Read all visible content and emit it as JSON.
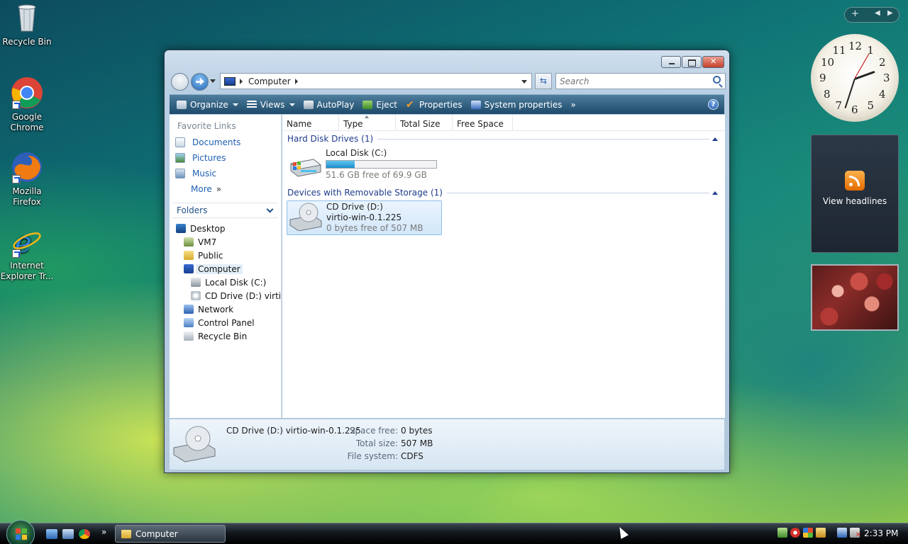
{
  "desktop": {
    "icons": [
      {
        "label": "Recycle Bin",
        "icon": "recycle-bin-icon"
      },
      {
        "label": "Google Chrome",
        "icon": "chrome-icon"
      },
      {
        "label": "Mozilla Firefox",
        "icon": "firefox-icon"
      },
      {
        "label": "Internet Explorer Tr...",
        "icon": "internet-explorer-icon"
      }
    ]
  },
  "window": {
    "address": {
      "segment": "Computer"
    },
    "search": {
      "placeholder": "Search"
    },
    "toolbar": {
      "organize": "Organize",
      "views": "Views",
      "autoplay": "AutoPlay",
      "eject": "Eject",
      "properties": "Properties",
      "system_properties": "System properties",
      "more": "»"
    },
    "nav_pane": {
      "favorites_header": "Favorite Links",
      "favorites": [
        "Documents",
        "Pictures",
        "Music"
      ],
      "more": "More",
      "folders_header": "Folders",
      "tree": [
        "Desktop",
        "VM7",
        "Public",
        "Computer",
        "Local Disk (C:)",
        "CD Drive (D:) virtio-",
        "Network",
        "Control Panel",
        "Recycle Bin"
      ]
    },
    "columns": [
      "Name",
      "Type",
      "Total Size",
      "Free Space"
    ],
    "groups": {
      "hdd": {
        "header": "Hard Disk Drives (1)",
        "drive": {
          "name": "Local Disk (C:)",
          "free": "51.6 GB free of 69.9 GB",
          "used_fraction": 0.26
        }
      },
      "removable": {
        "header": "Devices with Removable Storage (1)",
        "drive": {
          "name": "CD Drive (D:)",
          "label": "virtio-win-0.1.225",
          "free": "0 bytes free of 507 MB"
        }
      }
    },
    "details": {
      "title": "CD Drive (D:) virtio-win-0.1.225",
      "space_free_label": "Space free:",
      "space_free": "0 bytes",
      "total_size_label": "Total size:",
      "total_size": "507 MB",
      "file_system_label": "File system:",
      "file_system": "CDFS"
    }
  },
  "sidebar": {
    "clock": {
      "numbers": [
        "12",
        "1",
        "2",
        "3",
        "4",
        "5",
        "6",
        "7",
        "8",
        "9",
        "10",
        "11"
      ]
    },
    "feed": {
      "label": "View headlines"
    }
  },
  "taskbar": {
    "task": "Computer",
    "more": "»",
    "time": "2:33 PM"
  }
}
